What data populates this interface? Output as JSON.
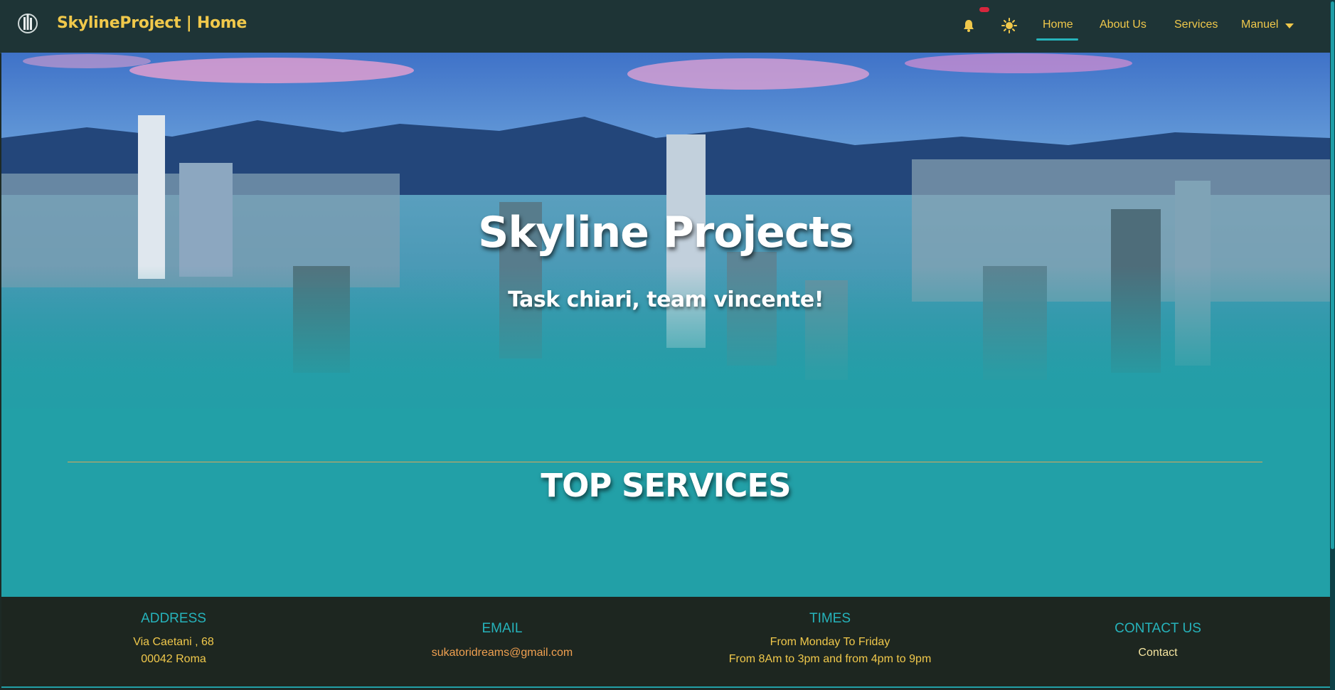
{
  "navbar": {
    "brand": "SkylineProject | Home",
    "links": {
      "home": "Home",
      "about": "About Us",
      "services": "Services",
      "user": "Manuel"
    }
  },
  "hero": {
    "title": "Skyline Projects",
    "subtitle": "Task chiari, team vincente!"
  },
  "section": {
    "title": "TOP SERVICES"
  },
  "footer": {
    "address": {
      "heading": "ADDRESS",
      "line1": "Via Caetani , 68",
      "line2": "00042 Roma"
    },
    "email": {
      "heading": "EMAIL",
      "value": "sukatoridreams@gmail.com"
    },
    "times": {
      "heading": "TIMES",
      "line1": "From Monday To Friday",
      "line2": "From 8Am to 3pm and from 4pm to 9pm"
    },
    "contact": {
      "heading": "CONTACT US",
      "link": "Contact"
    }
  },
  "colors": {
    "navbar_bg": "#1e3436",
    "accent_yellow": "#f0c84b",
    "accent_teal": "#26b3bb",
    "hero_teal": "#22a0a7",
    "footer_bg": "#1d2620",
    "badge_red": "#d7263d"
  },
  "icons": {
    "logo": "skyline-building-logo",
    "bell": "bell-icon",
    "theme": "sun-icon",
    "caret": "caret-down-icon"
  }
}
